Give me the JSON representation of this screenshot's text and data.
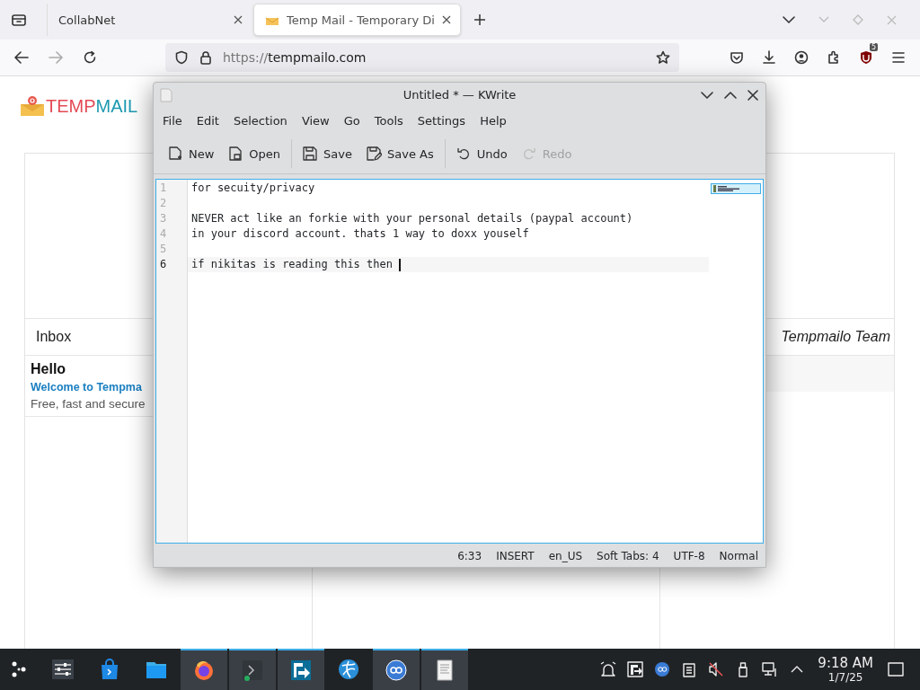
{
  "browser": {
    "tabs": [
      {
        "title": "CollabNet",
        "selected": false,
        "favicon": false
      },
      {
        "title": "Temp Mail - Temporary Di",
        "selected": true,
        "favicon": true
      }
    ],
    "url": {
      "scheme": "https://",
      "host": "tempmailo.com"
    },
    "forward_disabled": true,
    "extension_badge": "5"
  },
  "page": {
    "logo": {
      "start": "TEMP",
      "end": "MAIL"
    },
    "inbox_label": "Inbox",
    "sender": "Tempmailo Team",
    "message": {
      "subject": "Hello",
      "title": "Welcome to Tempma",
      "preview": "Free, fast and secure"
    }
  },
  "kwrite": {
    "title": "Untitled * — KWrite",
    "menu": [
      "File",
      "Edit",
      "Selection",
      "View",
      "Go",
      "Tools",
      "Settings",
      "Help"
    ],
    "toolbar": [
      {
        "kind": "new",
        "label": "New",
        "disabled": false
      },
      {
        "kind": "open",
        "label": "Open",
        "disabled": false
      },
      {
        "kind": "save",
        "label": "Save",
        "disabled": false
      },
      {
        "kind": "saveas",
        "label": "Save As",
        "disabled": false
      },
      {
        "kind": "undo",
        "label": "Undo",
        "disabled": false
      },
      {
        "kind": "redo",
        "label": "Redo",
        "disabled": true
      }
    ],
    "lines": [
      {
        "number": "1",
        "text": "for secuity/privacy",
        "current": false
      },
      {
        "number": "2",
        "current": false
      },
      {
        "number": "3",
        "text": "NEVER act like an forkie with your personal details (paypal account)",
        "current": false
      },
      {
        "number": "4",
        "text": "in your discord account. thats 1 way to doxx youself",
        "current": false
      },
      {
        "number": "5",
        "current": false
      },
      {
        "number": "6",
        "text": "if nikitas is reading this then ",
        "current": true
      }
    ],
    "status": [
      "6:33",
      "INSERT",
      "en_US",
      "Soft Tabs: 4",
      "UTF-8",
      "Normal"
    ]
  },
  "taskbar": {
    "apps": [
      {
        "kind": "launcher",
        "active": false
      },
      {
        "kind": "settings",
        "active": false
      },
      {
        "kind": "store",
        "active": false
      },
      {
        "kind": "files",
        "active": false
      },
      {
        "kind": "firefox",
        "active": true
      },
      {
        "kind": "terminal",
        "active": true
      },
      {
        "kind": "remote",
        "active": true
      },
      {
        "kind": "browser",
        "active": false
      },
      {
        "kind": "torrent",
        "active": true
      },
      {
        "kind": "editor",
        "active": true
      }
    ],
    "tray": [
      {
        "kind": "alarm"
      },
      {
        "kind": "remote"
      },
      {
        "kind": "torrent"
      },
      {
        "kind": "clipboard"
      },
      {
        "kind": "muted"
      },
      {
        "kind": "usb"
      },
      {
        "kind": "network"
      },
      {
        "kind": "expand"
      }
    ],
    "time": "9:18 AM",
    "date": "1/7/25"
  }
}
